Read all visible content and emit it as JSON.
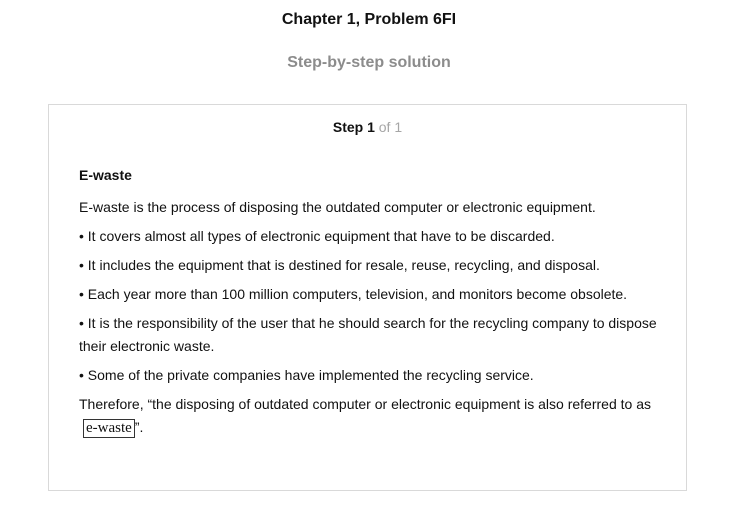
{
  "header": {
    "chapter_title": "Chapter 1, Problem 6FI",
    "subtitle": "Step-by-step solution"
  },
  "step": {
    "label": "Step 1",
    "of_text": " of 1",
    "heading": "E-waste",
    "intro": "E-waste is the process of disposing the outdated computer or electronic equipment.",
    "bullets": [
      "• It covers almost all types of electronic equipment that have to be discarded.",
      "• It includes the equipment that is destined for resale, reuse, recycling, and disposal.",
      "• Each year more than 100 million computers, television, and monitors become obsolete.",
      "• It is the responsibility of the user that he should search for the recycling company to dispose their electronic waste.",
      "• Some of the private companies have implemented the recycling service."
    ],
    "conclusion_prefix": "Therefore, “the disposing of outdated computer or electronic equipment is also referred to as",
    "answer": "e-waste",
    "conclusion_suffix": "”."
  }
}
